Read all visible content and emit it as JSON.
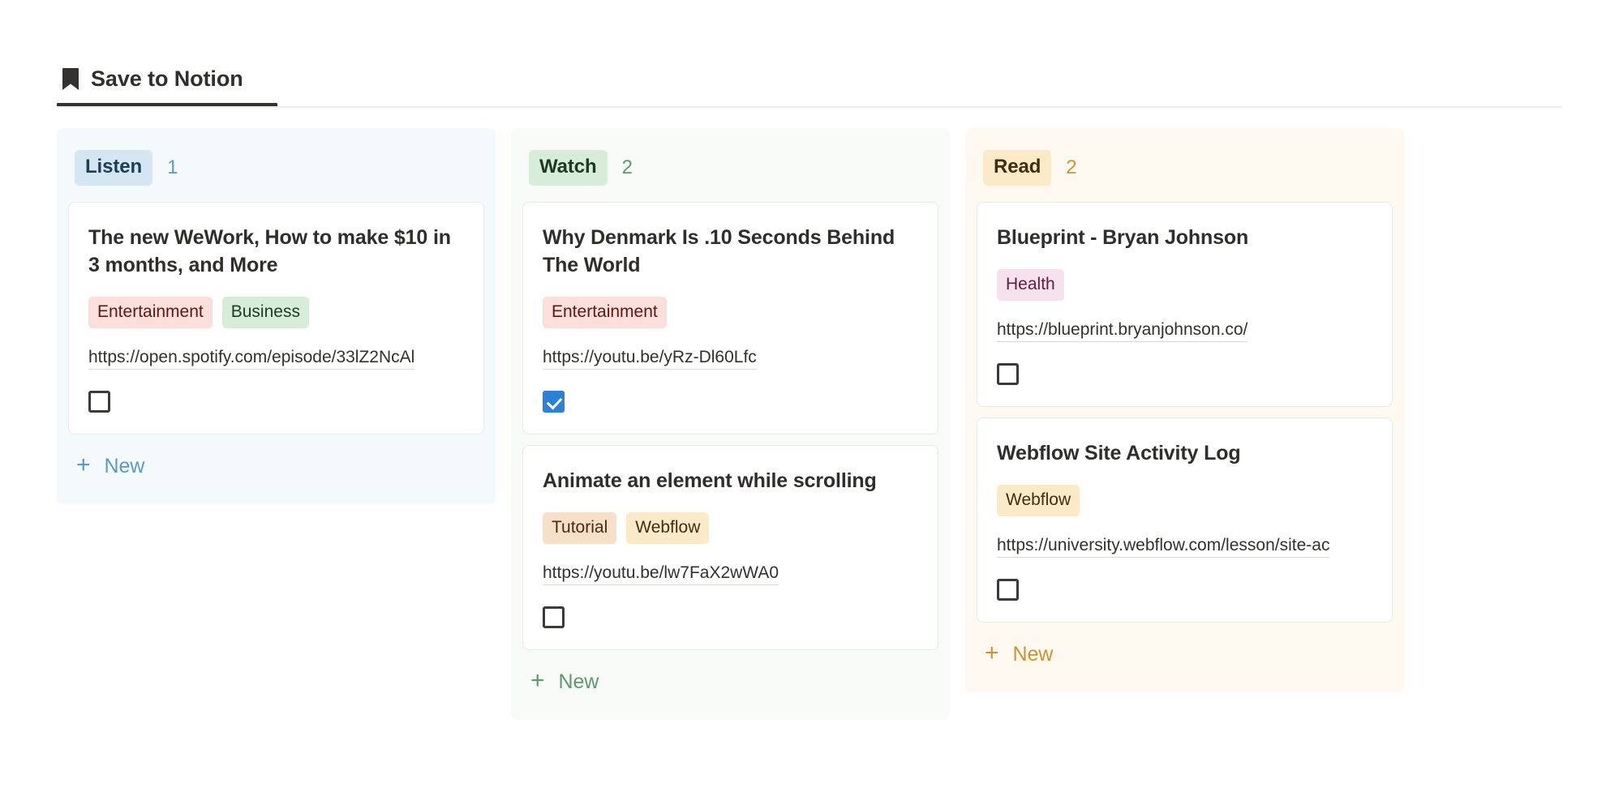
{
  "header": {
    "tab_label": "Save to Notion",
    "tab_icon": "bookmark-icon",
    "tab_active": true
  },
  "new_button_label": "New",
  "columns": [
    {
      "id": "listen",
      "name": "Listen",
      "count": "1",
      "chip_bg": "#d4e6f1",
      "chip_text": "#1d3d54",
      "accent": "#5b9ac4",
      "column_bg": "#f4f9fc",
      "new_label": "New",
      "cards": [
        {
          "title": "The new WeWork, How to make $10 in 3 months, and More",
          "tags": [
            {
              "label": "Entertainment",
              "color": "red"
            },
            {
              "label": "Business",
              "color": "green"
            }
          ],
          "url": "https://open.spotify.com/episode/33lZ2NcAl",
          "checked": false
        }
      ]
    },
    {
      "id": "watch",
      "name": "Watch",
      "count": "2",
      "chip_bg": "#d7ecd9",
      "chip_text": "#1c3a22",
      "accent": "#5f9a6d",
      "column_bg": "#f7faf7",
      "new_label": "New",
      "cards": [
        {
          "title": "Why Denmark Is .10 Seconds Behind The World",
          "tags": [
            {
              "label": "Entertainment",
              "color": "red"
            }
          ],
          "url": "https://youtu.be/yRz-Dl60Lfc",
          "checked": true
        },
        {
          "title": "Animate an element while scrolling",
          "tags": [
            {
              "label": "Tutorial",
              "color": "orange"
            },
            {
              "label": "Webflow",
              "color": "yellow"
            }
          ],
          "url": "https://youtu.be/lw7FaX2wWA0",
          "checked": false
        }
      ]
    },
    {
      "id": "read",
      "name": "Read",
      "count": "2",
      "chip_bg": "#fbeac7",
      "chip_text": "#3c2f10",
      "accent": "#cb9435",
      "column_bg": "#fdf9f1",
      "new_label": "New",
      "cards": [
        {
          "title": "Blueprint - Bryan Johnson",
          "tags": [
            {
              "label": "Health",
              "color": "pink"
            }
          ],
          "url": "https://blueprint.bryanjohnson.co/",
          "checked": false
        },
        {
          "title": "Webflow Site Activity Log",
          "tags": [
            {
              "label": "Webflow",
              "color": "yellow"
            }
          ],
          "url": "https://university.webflow.com/lesson/site-ac",
          "checked": false
        }
      ]
    }
  ]
}
